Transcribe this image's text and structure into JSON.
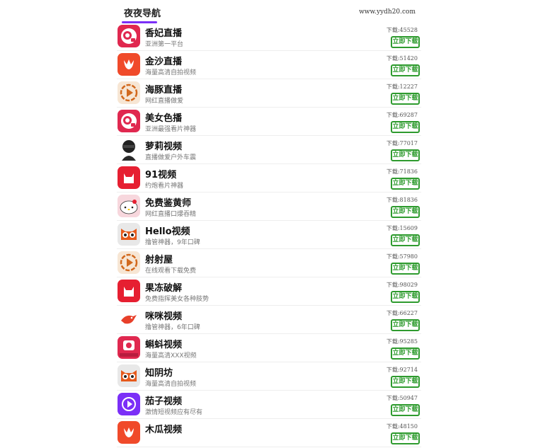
{
  "header": {
    "title": "夜夜导航",
    "site": "www.yydh20.com",
    "accent": "#7b2ff7"
  },
  "download_label": "立即下载",
  "apps": [
    {
      "name": "香妃直播",
      "desc": "亚洲第一平台",
      "count": "下载:45528",
      "icon": "camera-icon",
      "color": "#e0284f"
    },
    {
      "name": "金沙直播",
      "desc": "海量高清自拍视频",
      "count": "下载:51420",
      "icon": "tulip-icon",
      "color": "#f04a2a"
    },
    {
      "name": "海豚直播",
      "desc": "网红直播做爱",
      "count": "下载:12227",
      "icon": "play-icon",
      "color": "#f7e6d4"
    },
    {
      "name": "美女色播",
      "desc": "亚洲最强看片神器",
      "count": "下载:69287",
      "icon": "camera-icon",
      "color": "#e0284f"
    },
    {
      "name": "萝莉视频",
      "desc": "直播做爱户外车震",
      "count": "下载:77017",
      "icon": "anime-avatar-icon",
      "color": "#222"
    },
    {
      "name": "91视频",
      "desc": "约炮看片神器",
      "count": "下载:71836",
      "icon": "cat-icon",
      "color": "#e61f31"
    },
    {
      "name": "免费鉴黄师",
      "desc": "网红直播口爆吞精",
      "count": "下载:81836",
      "icon": "hello-kitty-icon",
      "color": "#f7d7dd"
    },
    {
      "name": "Hello视频",
      "desc": "撸管神器，9年口碑",
      "count": "下载:15609",
      "icon": "raccoon-icon",
      "color": "#e8e8e8"
    },
    {
      "name": "射射屋",
      "desc": "在线观看下载免费",
      "count": "下载:57980",
      "icon": "play-icon",
      "color": "#f7e6d4"
    },
    {
      "name": "果冻破解",
      "desc": "免费指挥美女各种肢势",
      "count": "下载:98029",
      "icon": "cat-icon",
      "color": "#e61f31"
    },
    {
      "name": "咪咪视频",
      "desc": "撸管神器，6年口碑",
      "count": "下载:66227",
      "icon": "bird-icon",
      "color": "#fff"
    },
    {
      "name": "蝌蚪视频",
      "desc": "海量高清XXX视频",
      "count": "下载:95285",
      "icon": "kedou-app-icon",
      "color": "#e0284f"
    },
    {
      "name": "知阴坊",
      "desc": "海量高清自拍视频",
      "count": "下载:92714",
      "icon": "raccoon-icon",
      "color": "#e8e8e8"
    },
    {
      "name": "茄子视频",
      "desc": "激情短视频应有尽有",
      "count": "下载:50947",
      "icon": "play-circle-icon",
      "color": "#7b2ff7"
    },
    {
      "name": "木瓜视频",
      "desc": "",
      "count": "下载:48150",
      "icon": "tulip-icon",
      "color": "#f04a2a"
    }
  ]
}
